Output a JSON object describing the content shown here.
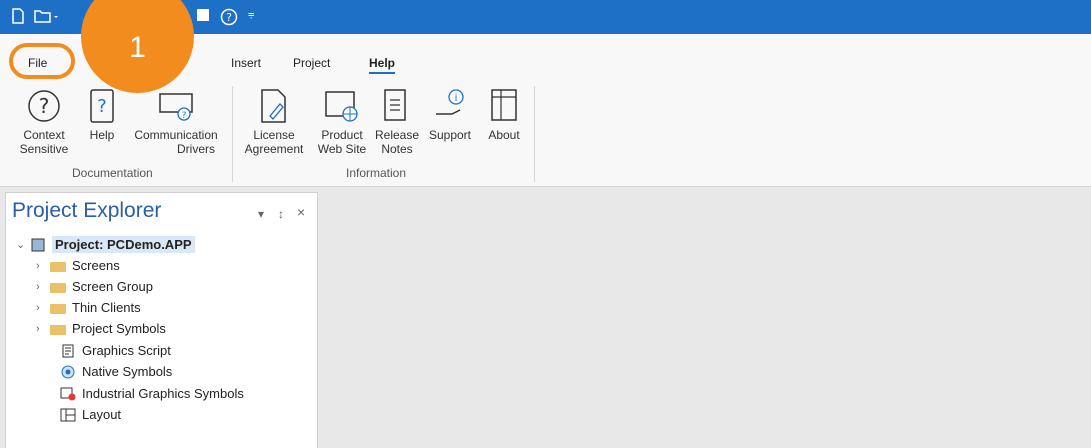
{
  "tabs": [
    "File",
    "Insert",
    "Project",
    "Help"
  ],
  "callout_number": "1",
  "ribbon": {
    "documentation": {
      "group_label": "Documentation",
      "buttons": [
        {
          "line1": "Context",
          "line2": "Sensitive"
        },
        {
          "line1": "Help",
          "line2": ""
        },
        {
          "line1": "Communication",
          "line2": "Drivers"
        }
      ]
    },
    "information": {
      "group_label": "Information",
      "buttons": [
        {
          "line1": "License",
          "line2": "Agreement"
        },
        {
          "line1": "Product",
          "line2": "Web Site"
        },
        {
          "line1": "Release",
          "line2": "Notes"
        },
        {
          "line1": "Support",
          "line2": ""
        },
        {
          "line1": "About",
          "line2": ""
        }
      ]
    }
  },
  "panel": {
    "title": "Project Explorer",
    "pin_glyph": "↕",
    "close_glyph": "×",
    "dropdown_glyph": "▾"
  },
  "tree": {
    "root": "Project: PCDemo.APP",
    "items": [
      {
        "label": "Screens",
        "icon": "folder-icon",
        "expandable": true
      },
      {
        "label": "Screen Group",
        "icon": "folder-icon",
        "expandable": true
      },
      {
        "label": "Thin Clients",
        "icon": "folder-icon",
        "expandable": true
      },
      {
        "label": "Project Symbols",
        "icon": "folder-icon",
        "expandable": true
      },
      {
        "label": "Graphics Script",
        "icon": "script-icon",
        "expandable": false
      },
      {
        "label": "Native Symbols",
        "icon": "native-symbols-icon",
        "expandable": false
      },
      {
        "label": "Industrial Graphics Symbols",
        "icon": "industrial-graphics-icon",
        "expandable": false
      },
      {
        "label": "Layout",
        "icon": "layout-icon",
        "expandable": false
      }
    ]
  },
  "colors": {
    "accent": "#1e6fc6",
    "callout": "#f28c1e",
    "panel_title": "#2b5ea8"
  }
}
